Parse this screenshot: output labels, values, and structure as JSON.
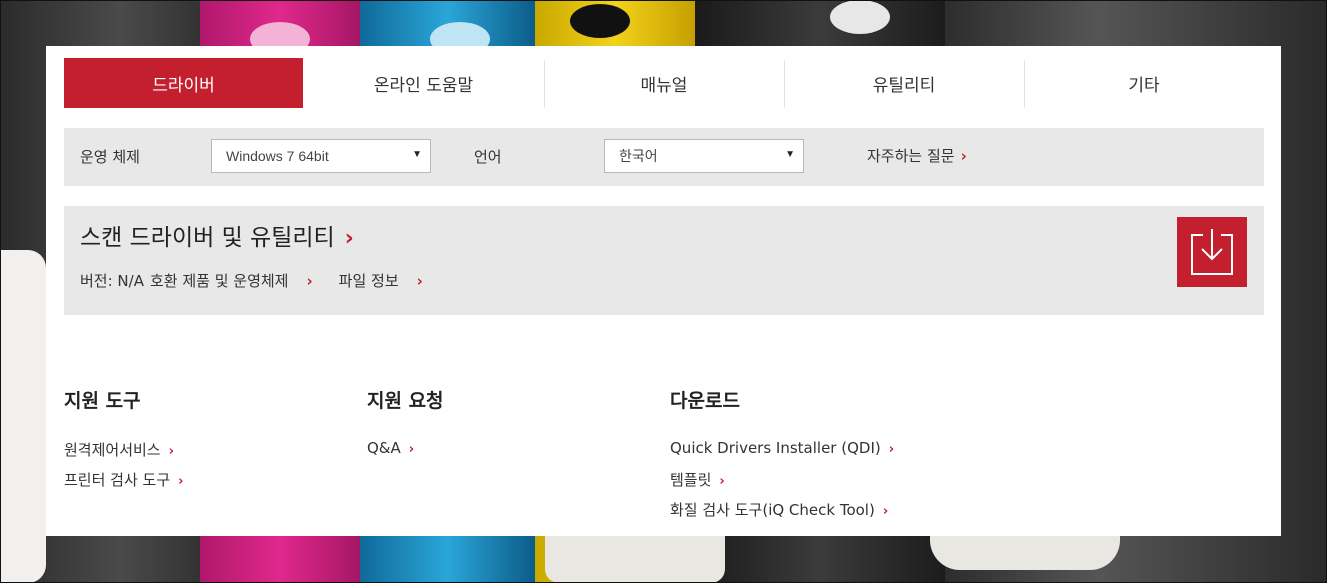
{
  "tabs": [
    {
      "label": "드라이버",
      "active": true
    },
    {
      "label": "온라인 도움말",
      "active": false
    },
    {
      "label": "매뉴얼",
      "active": false
    },
    {
      "label": "유틸리티",
      "active": false
    },
    {
      "label": "기타",
      "active": false
    }
  ],
  "filter": {
    "os_label": "운영 체제",
    "os_value": "Windows 7 64bit",
    "lang_label": "언어",
    "lang_value": "한국어",
    "faq_label": "자주하는 질문"
  },
  "driver": {
    "title": "스캔 드라이버 및 유틸리티",
    "version": "버전: N/A",
    "compat_label": "호환 제품 및 운영체제",
    "file_info_label": "파일 정보"
  },
  "footer": {
    "support_tools": {
      "heading": "지원 도구",
      "links": [
        "원격제어서비스",
        "프린터 검사 도구"
      ]
    },
    "support_request": {
      "heading": "지원 요청",
      "links": [
        "Q&A"
      ]
    },
    "downloads": {
      "heading": "다운로드",
      "links": [
        "Quick Drivers Installer (QDI)",
        "템플릿",
        "화질 검사 도구(iQ Check Tool)"
      ]
    }
  },
  "colors": {
    "accent": "#c41f2f",
    "panel_gray": "#e8e8e8"
  },
  "icons": {
    "select_arrow": "triangle-down-icon",
    "chevron": "chevron-right-icon",
    "download": "download-icon"
  }
}
